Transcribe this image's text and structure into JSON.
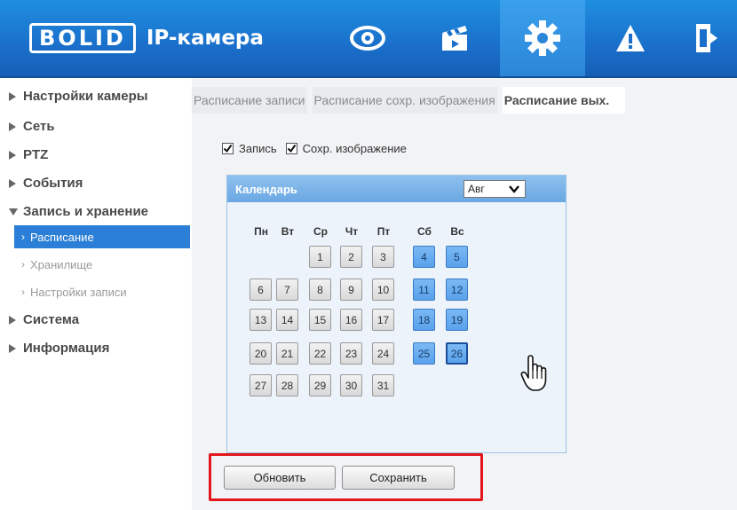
{
  "header": {
    "logo": "BOLID",
    "title": "IP-камера",
    "nav": [
      {
        "icon": "eye-icon"
      },
      {
        "icon": "clapperboard-icon"
      },
      {
        "icon": "gear-icon",
        "active": true
      },
      {
        "icon": "warning-icon"
      },
      {
        "icon": "logout-icon"
      }
    ]
  },
  "sidebar": {
    "items": [
      {
        "label": "Настройки камеры"
      },
      {
        "label": "Сеть"
      },
      {
        "label": "PTZ"
      },
      {
        "label": "События"
      },
      {
        "label": "Запись и хранение",
        "expanded": true
      },
      {
        "label": "Система"
      },
      {
        "label": "Информация"
      }
    ],
    "subitems": [
      {
        "label": "Расписание",
        "active": true
      },
      {
        "label": "Хранилище"
      },
      {
        "label": "Настройки записи"
      }
    ]
  },
  "tabs": [
    {
      "label": "Расписание записи"
    },
    {
      "label": "Расписание сохр. изображения"
    },
    {
      "label": "Расписание вых.",
      "active": true
    }
  ],
  "checkboxes": [
    {
      "label": "Запись",
      "checked": true
    },
    {
      "label": "Сохр. изображение",
      "checked": true
    }
  ],
  "calendar": {
    "title": "Календарь",
    "month": "Авг",
    "weekdays": [
      "Пн",
      "Вт",
      "Ср",
      "Чт",
      "Пт",
      "Сб",
      "Вс"
    ],
    "weeks": [
      [
        "",
        "",
        "1",
        "2",
        "3",
        "4",
        "5"
      ],
      [
        "6",
        "7",
        "8",
        "9",
        "10",
        "11",
        "12"
      ],
      [
        "13",
        "14",
        "15",
        "16",
        "17",
        "18",
        "19"
      ],
      [
        "20",
        "21",
        "22",
        "23",
        "24",
        "25",
        "26"
      ],
      [
        "27",
        "28",
        "29",
        "30",
        "31",
        "",
        ""
      ]
    ],
    "selected_day": "26"
  },
  "buttons": {
    "refresh": "Обновить",
    "save": "Сохранить"
  },
  "colors": {
    "header": "#1a6fcb",
    "weekend_day": "#6aaeef",
    "highlight": "#e3161d"
  }
}
